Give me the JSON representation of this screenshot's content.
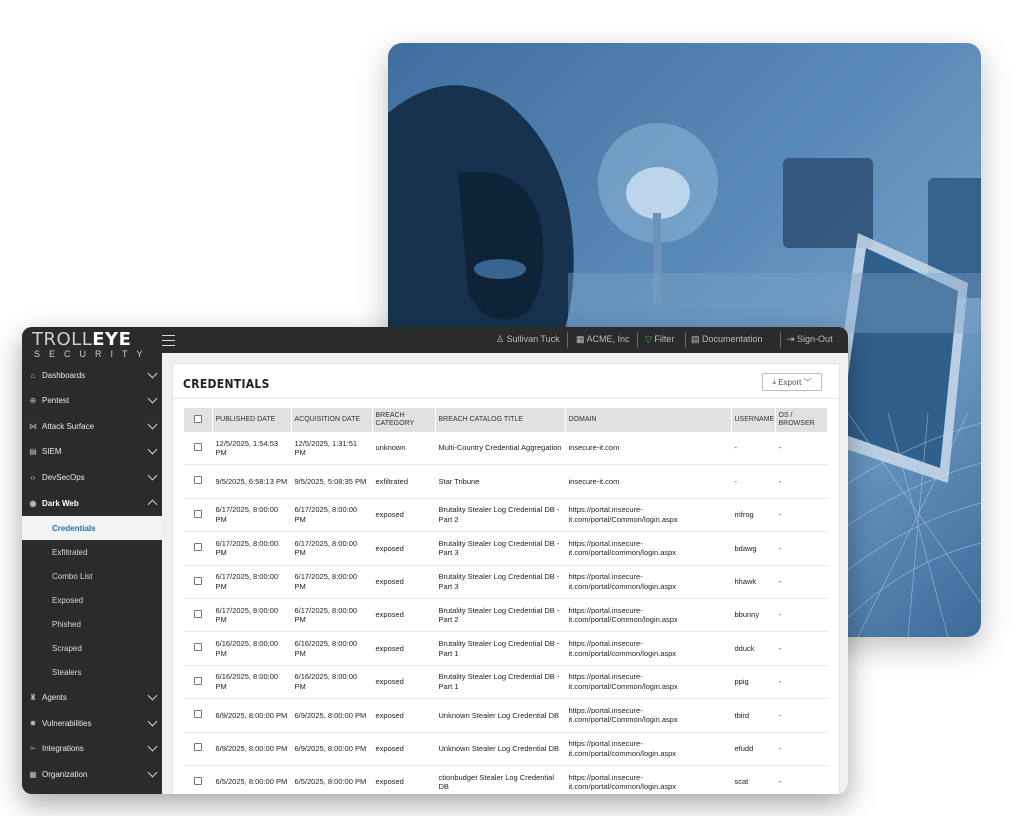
{
  "brand": {
    "logo_top_light": "TR",
    "logo_top_o": "OLL",
    "logo_top_bold": "EYE",
    "logo_bottom": "SECURITY"
  },
  "topbar": {
    "user": "Sullivan Tuck",
    "org": "ACME, Inc",
    "filter": "Filter",
    "docs": "Documentation",
    "signout": "Sign-Out"
  },
  "sidebar": {
    "items": [
      {
        "label": "Dashboards",
        "icon": "home-icon"
      },
      {
        "label": "Pentest",
        "icon": "target-icon"
      },
      {
        "label": "Attack Surface",
        "icon": "network-icon"
      },
      {
        "label": "SIEM",
        "icon": "server-icon"
      },
      {
        "label": "DevSecOps",
        "icon": "code-icon"
      },
      {
        "label": "Dark Web",
        "icon": "eye-icon"
      },
      {
        "label": "Agents",
        "icon": "agent-icon"
      },
      {
        "label": "Vulnerabilities",
        "icon": "bug-icon"
      },
      {
        "label": "Integrations",
        "icon": "integration-icon"
      },
      {
        "label": "Organization",
        "icon": "building-icon"
      }
    ],
    "darkweb_sub": [
      "Credentials",
      "Exfiltrated",
      "Combo List",
      "Exposed",
      "Phished",
      "Scraped",
      "Stealers"
    ]
  },
  "page": {
    "title": "CREDENTIALS",
    "export_label": "Export"
  },
  "table": {
    "headers": [
      "PUBLISHED DATE",
      "ACQUISITION DATE",
      "BREACH CATEGORY",
      "BREACH CATALOG TITLE",
      "DOMAIN",
      "USERNAME",
      "OS / BROWSER"
    ],
    "rows": [
      [
        "12/5/2025, 1:54:53 PM",
        "12/5/2025, 1:31:51 PM",
        "unknown",
        "Multi-Country Credential Aggregation",
        "insecure-it.com",
        "-",
        "-"
      ],
      [
        "9/5/2025, 6:58:13 PM",
        "9/5/2025, 5:08:35 PM",
        "exfiltrated",
        "Star Tribune",
        "insecure-it.com",
        "-",
        "-"
      ],
      [
        "6/17/2025, 8:00:00 PM",
        "6/17/2025, 8:00:00 PM",
        "exposed",
        "Brutality Stealer Log Credential DB - Part 2",
        "https://portal.insecure-it.com/portal/Common/login.aspx",
        "mfrog",
        "-"
      ],
      [
        "6/17/2025, 8:00:00 PM",
        "6/17/2025, 8:00:00 PM",
        "exposed",
        "Brutality Stealer Log Credential DB - Part 3",
        "https://portal.insecure-it.com/portal/common/login.aspx",
        "bdawg",
        "-"
      ],
      [
        "6/17/2025, 8:00:00 PM",
        "6/17/2025, 8:00:00 PM",
        "exposed",
        "Brutality Stealer Log Credential DB - Part 3",
        "https://portal.insecure-it.com/portal/common/login.aspx",
        "hhawk",
        "-"
      ],
      [
        "6/17/2025, 8:00:00 PM",
        "6/17/2025, 8:00:00 PM",
        "exposed",
        "Brutality Stealer Log Credential DB - Part 2",
        "https://portal.insecure-it.com/portal/Common/login.aspx",
        "bbunny",
        "-"
      ],
      [
        "6/16/2025, 8:00:00 PM",
        "6/16/2025, 8:00:00 PM",
        "exposed",
        "Brutality Stealer Log Credential DB - Part 1",
        "https://portal.insecure-it.com/portal/common/login.aspx",
        "dduck",
        "-"
      ],
      [
        "6/16/2025, 8:00:00 PM",
        "6/16/2025, 8:00:00 PM",
        "exposed",
        "Brutality Stealer Log Credential DB - Part 1",
        "https://portal.insecure-it.com/portal/Common/login.aspx",
        "ppig",
        "-"
      ],
      [
        "6/9/2025, 8:00:00 PM",
        "6/9/2025, 8:00:00 PM",
        "exposed",
        "Unknown Stealer Log Credential DB",
        "https://portal.insecure-it.com/portal/Common/login.aspx",
        "tbird",
        "-"
      ],
      [
        "6/9/2025, 8:00:00 PM",
        "6/9/2025, 8:00:00 PM",
        "exposed",
        "Unknown Stealer Log Credential DB",
        "https://portal.insecure-it.com/portal/common/login.aspx",
        "efudd",
        "-"
      ],
      [
        "6/5/2025, 8:00:00 PM",
        "6/5/2025, 8:00:00 PM",
        "exposed",
        "ctionbudget Stealer Log Credential DB",
        "https://portal.insecure-it.com/portal/common/login.aspx",
        "scat",
        "-"
      ]
    ]
  },
  "colors": {
    "sidebar": "#2b2b2b",
    "accent": "#1f6fb5",
    "hero": "#4f80b0"
  }
}
